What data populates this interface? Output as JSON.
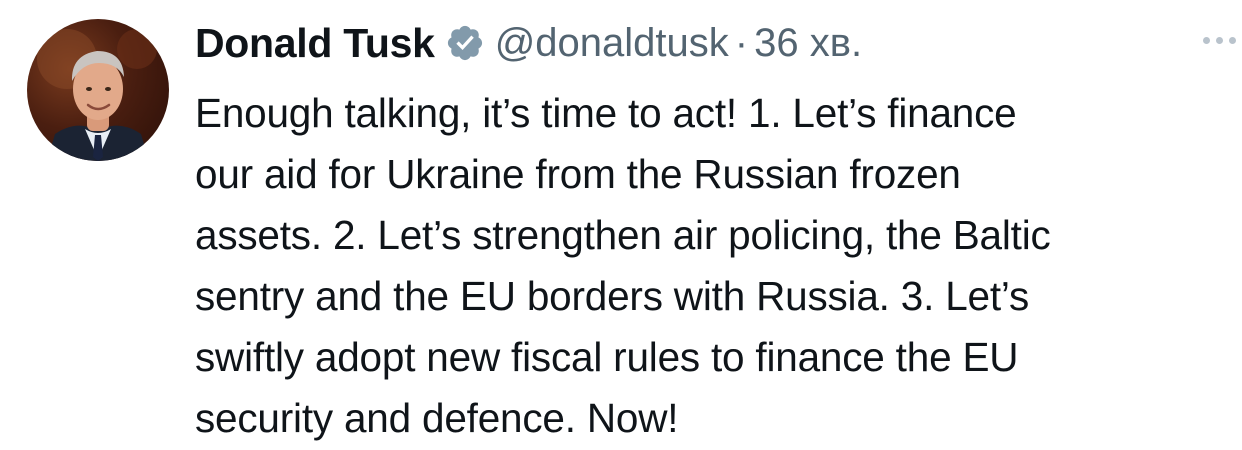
{
  "author": {
    "name": "Donald Tusk",
    "handle": "@donaldtusk",
    "separator": "·",
    "time": "36 хв."
  },
  "tweet": {
    "lines": [
      "Enough talking, it’s time to act! 1. Let’s finance",
      "our aid for Ukraine from the Russian frozen",
      "assets. 2. Let’s strengthen air policing, the Baltic",
      "sentry and the EU borders with Russia. 3. Let’s",
      "swiftly adopt new fiscal rules to finance the EU",
      "security and defence. Now!"
    ]
  },
  "icons": {
    "verified": "verified-badge-icon",
    "more": "more-options-icon"
  },
  "colors": {
    "verified_badge": "#829aab",
    "secondary_text": "#536471",
    "primary_text": "#0f1419"
  }
}
